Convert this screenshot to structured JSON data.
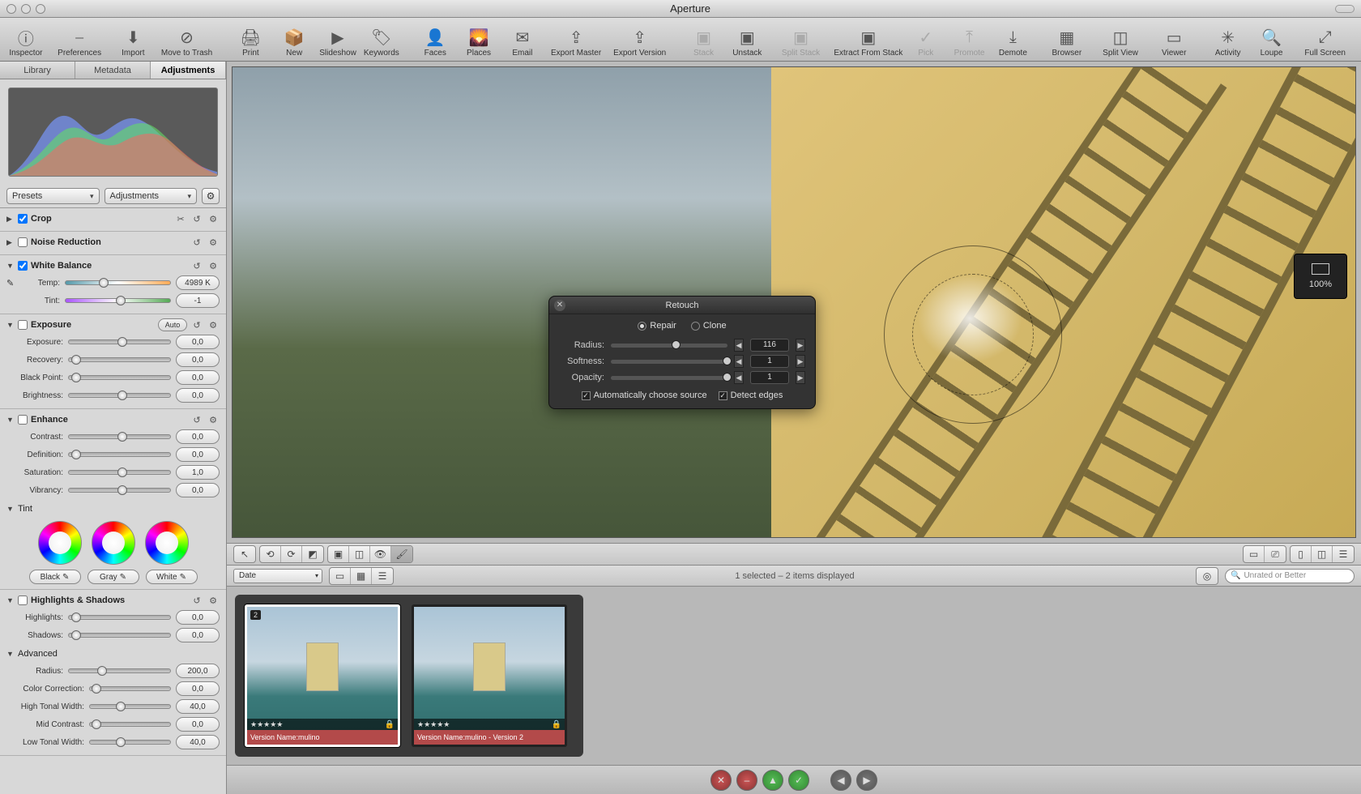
{
  "app_title": "Aperture",
  "toolbar": [
    {
      "label": "Inspector",
      "icon": "ⓘ"
    },
    {
      "label": "Preferences",
      "icon": "⎯"
    },
    {
      "label": "Import",
      "icon": "⬇"
    },
    {
      "label": "Move to Trash",
      "icon": "⊘"
    },
    {
      "label": "Print",
      "icon": "🖨"
    },
    {
      "label": "New",
      "icon": "📦"
    },
    {
      "label": "Slideshow",
      "icon": "▶"
    },
    {
      "label": "Keywords",
      "icon": "🏷"
    },
    {
      "label": "Faces",
      "icon": "👤"
    },
    {
      "label": "Places",
      "icon": "🌄"
    },
    {
      "label": "Email",
      "icon": "✉"
    },
    {
      "label": "Export Master",
      "icon": "⇪"
    },
    {
      "label": "Export Version",
      "icon": "⇪"
    },
    {
      "label": "Stack",
      "icon": "▣",
      "disabled": true
    },
    {
      "label": "Unstack",
      "icon": "▣"
    },
    {
      "label": "Split Stack",
      "icon": "▣",
      "disabled": true
    },
    {
      "label": "Extract From Stack",
      "icon": "▣"
    },
    {
      "label": "Pick",
      "icon": "✓",
      "disabled": true
    },
    {
      "label": "Promote",
      "icon": "⤒",
      "disabled": true
    },
    {
      "label": "Demote",
      "icon": "⤓"
    },
    {
      "label": "Browser",
      "icon": "▦"
    },
    {
      "label": "Split View",
      "icon": "◫"
    },
    {
      "label": "Viewer",
      "icon": "▭"
    },
    {
      "label": "Activity",
      "icon": "✳"
    },
    {
      "label": "Loupe",
      "icon": "🔍"
    },
    {
      "label": "Full Screen",
      "icon": "⤢"
    }
  ],
  "tabs": {
    "library": "Library",
    "metadata": "Metadata",
    "adjustments": "Adjustments"
  },
  "presets_dd": "Presets",
  "adjust_dd": "Adjustments",
  "sections": {
    "crop": {
      "name": "Crop",
      "checked": true
    },
    "noise": {
      "name": "Noise Reduction",
      "checked": false
    },
    "wb": {
      "name": "White Balance",
      "checked": true,
      "temp_label": "Temp:",
      "temp_value": "4989 K",
      "tint_label": "Tint:",
      "tint_value": "-1"
    },
    "exposure": {
      "name": "Exposure",
      "checked": false,
      "auto": "Auto",
      "params": [
        {
          "label": "Exposure:",
          "value": "0,0"
        },
        {
          "label": "Recovery:",
          "value": "0,0"
        },
        {
          "label": "Black Point:",
          "value": "0,0"
        },
        {
          "label": "Brightness:",
          "value": "0,0"
        }
      ]
    },
    "enhance": {
      "name": "Enhance",
      "checked": false,
      "params": [
        {
          "label": "Contrast:",
          "value": "0,0"
        },
        {
          "label": "Definition:",
          "value": "0,0"
        },
        {
          "label": "Saturation:",
          "value": "1,0"
        },
        {
          "label": "Vibrancy:",
          "value": "0,0"
        }
      ],
      "tint_header": "Tint",
      "tint_buttons": [
        "Black",
        "Gray",
        "White"
      ]
    },
    "hs": {
      "name": "Highlights & Shadows",
      "checked": false,
      "params": [
        {
          "label": "Highlights:",
          "value": "0,0"
        },
        {
          "label": "Shadows:",
          "value": "0,0"
        }
      ],
      "adv": "Advanced",
      "adv_params": [
        {
          "label": "Radius:",
          "value": "200,0"
        },
        {
          "label": "Color Correction:",
          "value": "0,0"
        },
        {
          "label": "High Tonal Width:",
          "value": "40,0"
        },
        {
          "label": "Mid Contrast:",
          "value": "0,0"
        },
        {
          "label": "Low Tonal Width:",
          "value": "40,0"
        }
      ]
    }
  },
  "retouch": {
    "title": "Retouch",
    "repair": "Repair",
    "clone": "Clone",
    "repair_selected": true,
    "radius_label": "Radius:",
    "radius_value": "116",
    "softness_label": "Softness:",
    "softness_value": "1",
    "opacity_label": "Opacity:",
    "opacity_value": "1",
    "auto_src": "Automatically choose source",
    "auto_src_checked": true,
    "detect": "Detect edges",
    "detect_checked": true
  },
  "zoom": "100%",
  "sort_by": "Date",
  "status": "1 selected – 2 items displayed",
  "search_placeholder": "Unrated or Better",
  "thumbs": [
    {
      "badge": "2",
      "stars": "★★★★★",
      "vn_label": "Version Name:",
      "vn": "mulino",
      "selected": true
    },
    {
      "stars": "★★★★★",
      "vn_label": "Version Name:",
      "vn": "mulino - Version 2",
      "selected": false
    }
  ]
}
